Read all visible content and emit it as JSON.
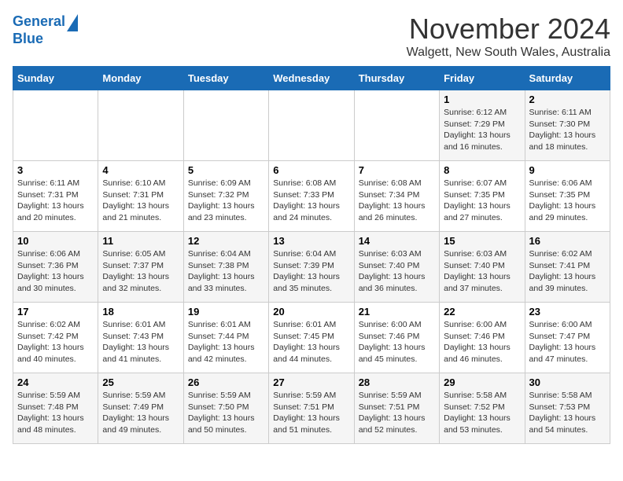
{
  "header": {
    "logo_line1": "General",
    "logo_line2": "Blue",
    "month_title": "November 2024",
    "subtitle": "Walgett, New South Wales, Australia"
  },
  "weekdays": [
    "Sunday",
    "Monday",
    "Tuesday",
    "Wednesday",
    "Thursday",
    "Friday",
    "Saturday"
  ],
  "weeks": [
    [
      {
        "day": "",
        "info": ""
      },
      {
        "day": "",
        "info": ""
      },
      {
        "day": "",
        "info": ""
      },
      {
        "day": "",
        "info": ""
      },
      {
        "day": "",
        "info": ""
      },
      {
        "day": "1",
        "info": "Sunrise: 6:12 AM\nSunset: 7:29 PM\nDaylight: 13 hours\nand 16 minutes."
      },
      {
        "day": "2",
        "info": "Sunrise: 6:11 AM\nSunset: 7:30 PM\nDaylight: 13 hours\nand 18 minutes."
      }
    ],
    [
      {
        "day": "3",
        "info": "Sunrise: 6:11 AM\nSunset: 7:31 PM\nDaylight: 13 hours\nand 20 minutes."
      },
      {
        "day": "4",
        "info": "Sunrise: 6:10 AM\nSunset: 7:31 PM\nDaylight: 13 hours\nand 21 minutes."
      },
      {
        "day": "5",
        "info": "Sunrise: 6:09 AM\nSunset: 7:32 PM\nDaylight: 13 hours\nand 23 minutes."
      },
      {
        "day": "6",
        "info": "Sunrise: 6:08 AM\nSunset: 7:33 PM\nDaylight: 13 hours\nand 24 minutes."
      },
      {
        "day": "7",
        "info": "Sunrise: 6:08 AM\nSunset: 7:34 PM\nDaylight: 13 hours\nand 26 minutes."
      },
      {
        "day": "8",
        "info": "Sunrise: 6:07 AM\nSunset: 7:35 PM\nDaylight: 13 hours\nand 27 minutes."
      },
      {
        "day": "9",
        "info": "Sunrise: 6:06 AM\nSunset: 7:35 PM\nDaylight: 13 hours\nand 29 minutes."
      }
    ],
    [
      {
        "day": "10",
        "info": "Sunrise: 6:06 AM\nSunset: 7:36 PM\nDaylight: 13 hours\nand 30 minutes."
      },
      {
        "day": "11",
        "info": "Sunrise: 6:05 AM\nSunset: 7:37 PM\nDaylight: 13 hours\nand 32 minutes."
      },
      {
        "day": "12",
        "info": "Sunrise: 6:04 AM\nSunset: 7:38 PM\nDaylight: 13 hours\nand 33 minutes."
      },
      {
        "day": "13",
        "info": "Sunrise: 6:04 AM\nSunset: 7:39 PM\nDaylight: 13 hours\nand 35 minutes."
      },
      {
        "day": "14",
        "info": "Sunrise: 6:03 AM\nSunset: 7:40 PM\nDaylight: 13 hours\nand 36 minutes."
      },
      {
        "day": "15",
        "info": "Sunrise: 6:03 AM\nSunset: 7:40 PM\nDaylight: 13 hours\nand 37 minutes."
      },
      {
        "day": "16",
        "info": "Sunrise: 6:02 AM\nSunset: 7:41 PM\nDaylight: 13 hours\nand 39 minutes."
      }
    ],
    [
      {
        "day": "17",
        "info": "Sunrise: 6:02 AM\nSunset: 7:42 PM\nDaylight: 13 hours\nand 40 minutes."
      },
      {
        "day": "18",
        "info": "Sunrise: 6:01 AM\nSunset: 7:43 PM\nDaylight: 13 hours\nand 41 minutes."
      },
      {
        "day": "19",
        "info": "Sunrise: 6:01 AM\nSunset: 7:44 PM\nDaylight: 13 hours\nand 42 minutes."
      },
      {
        "day": "20",
        "info": "Sunrise: 6:01 AM\nSunset: 7:45 PM\nDaylight: 13 hours\nand 44 minutes."
      },
      {
        "day": "21",
        "info": "Sunrise: 6:00 AM\nSunset: 7:46 PM\nDaylight: 13 hours\nand 45 minutes."
      },
      {
        "day": "22",
        "info": "Sunrise: 6:00 AM\nSunset: 7:46 PM\nDaylight: 13 hours\nand 46 minutes."
      },
      {
        "day": "23",
        "info": "Sunrise: 6:00 AM\nSunset: 7:47 PM\nDaylight: 13 hours\nand 47 minutes."
      }
    ],
    [
      {
        "day": "24",
        "info": "Sunrise: 5:59 AM\nSunset: 7:48 PM\nDaylight: 13 hours\nand 48 minutes."
      },
      {
        "day": "25",
        "info": "Sunrise: 5:59 AM\nSunset: 7:49 PM\nDaylight: 13 hours\nand 49 minutes."
      },
      {
        "day": "26",
        "info": "Sunrise: 5:59 AM\nSunset: 7:50 PM\nDaylight: 13 hours\nand 50 minutes."
      },
      {
        "day": "27",
        "info": "Sunrise: 5:59 AM\nSunset: 7:51 PM\nDaylight: 13 hours\nand 51 minutes."
      },
      {
        "day": "28",
        "info": "Sunrise: 5:59 AM\nSunset: 7:51 PM\nDaylight: 13 hours\nand 52 minutes."
      },
      {
        "day": "29",
        "info": "Sunrise: 5:58 AM\nSunset: 7:52 PM\nDaylight: 13 hours\nand 53 minutes."
      },
      {
        "day": "30",
        "info": "Sunrise: 5:58 AM\nSunset: 7:53 PM\nDaylight: 13 hours\nand 54 minutes."
      }
    ]
  ]
}
